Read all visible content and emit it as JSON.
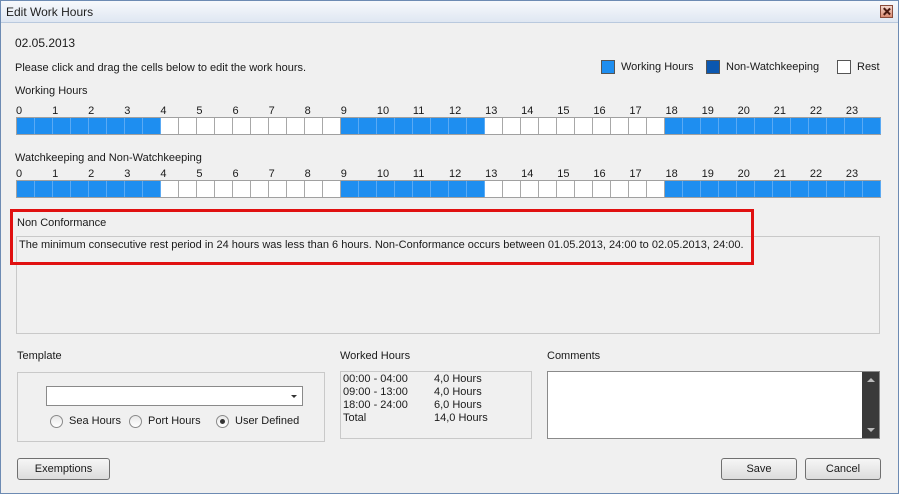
{
  "window": {
    "title": "Edit Work Hours"
  },
  "date": "02.05.2013",
  "instruction": "Please click and drag the cells below to edit the work hours.",
  "legend": [
    {
      "label": "Working Hours",
      "color": "#1e8ef0"
    },
    {
      "label": "Non-Watchkeeping",
      "color": "#0b57b0"
    },
    {
      "label": "Rest",
      "color": "#ffffff"
    }
  ],
  "hours": [
    "0",
    "1",
    "2",
    "3",
    "4",
    "5",
    "6",
    "7",
    "8",
    "9",
    "10",
    "11",
    "12",
    "13",
    "14",
    "15",
    "16",
    "17",
    "18",
    "19",
    "20",
    "21",
    "22",
    "23"
  ],
  "working_hours": {
    "label": "Working Hours",
    "cells": [
      1,
      1,
      1,
      1,
      1,
      1,
      1,
      1,
      0,
      0,
      0,
      0,
      0,
      0,
      0,
      0,
      0,
      0,
      1,
      1,
      1,
      1,
      1,
      1,
      1,
      1,
      0,
      0,
      0,
      0,
      0,
      0,
      0,
      0,
      0,
      0,
      1,
      1,
      1,
      1,
      1,
      1,
      1,
      1,
      1,
      1,
      1,
      1
    ]
  },
  "watchkeeping": {
    "label": "Watchkeeping and Non-Watchkeeping",
    "cells": [
      1,
      1,
      1,
      1,
      1,
      1,
      1,
      1,
      0,
      0,
      0,
      0,
      0,
      0,
      0,
      0,
      0,
      0,
      1,
      1,
      1,
      1,
      1,
      1,
      1,
      1,
      0,
      0,
      0,
      0,
      0,
      0,
      0,
      0,
      0,
      0,
      1,
      1,
      1,
      1,
      1,
      1,
      1,
      1,
      1,
      1,
      1,
      1
    ]
  },
  "non_conformance": {
    "label": "Non Conformance",
    "text": "The minimum consecutive rest period in 24 hours was less than 6 hours. Non-Conformance occurs between 01.05.2013, 24:00 to 02.05.2013, 24:00."
  },
  "template": {
    "label": "Template",
    "selected": "",
    "options": [
      {
        "label": "Sea Hours",
        "checked": false
      },
      {
        "label": "Port Hours",
        "checked": false
      },
      {
        "label": "User Defined",
        "checked": true
      }
    ]
  },
  "worked_hours": {
    "label": "Worked Hours",
    "rows": [
      {
        "range": "00:00 - 04:00",
        "hours": "4,0 Hours"
      },
      {
        "range": "09:00 - 13:00",
        "hours": "4,0 Hours"
      },
      {
        "range": "18:00 - 24:00",
        "hours": "6,0 Hours"
      },
      {
        "range": "Total",
        "hours": "14,0 Hours"
      }
    ]
  },
  "comments": {
    "label": "Comments",
    "value": ""
  },
  "buttons": {
    "exemptions": "Exemptions",
    "save": "Save",
    "cancel": "Cancel"
  }
}
